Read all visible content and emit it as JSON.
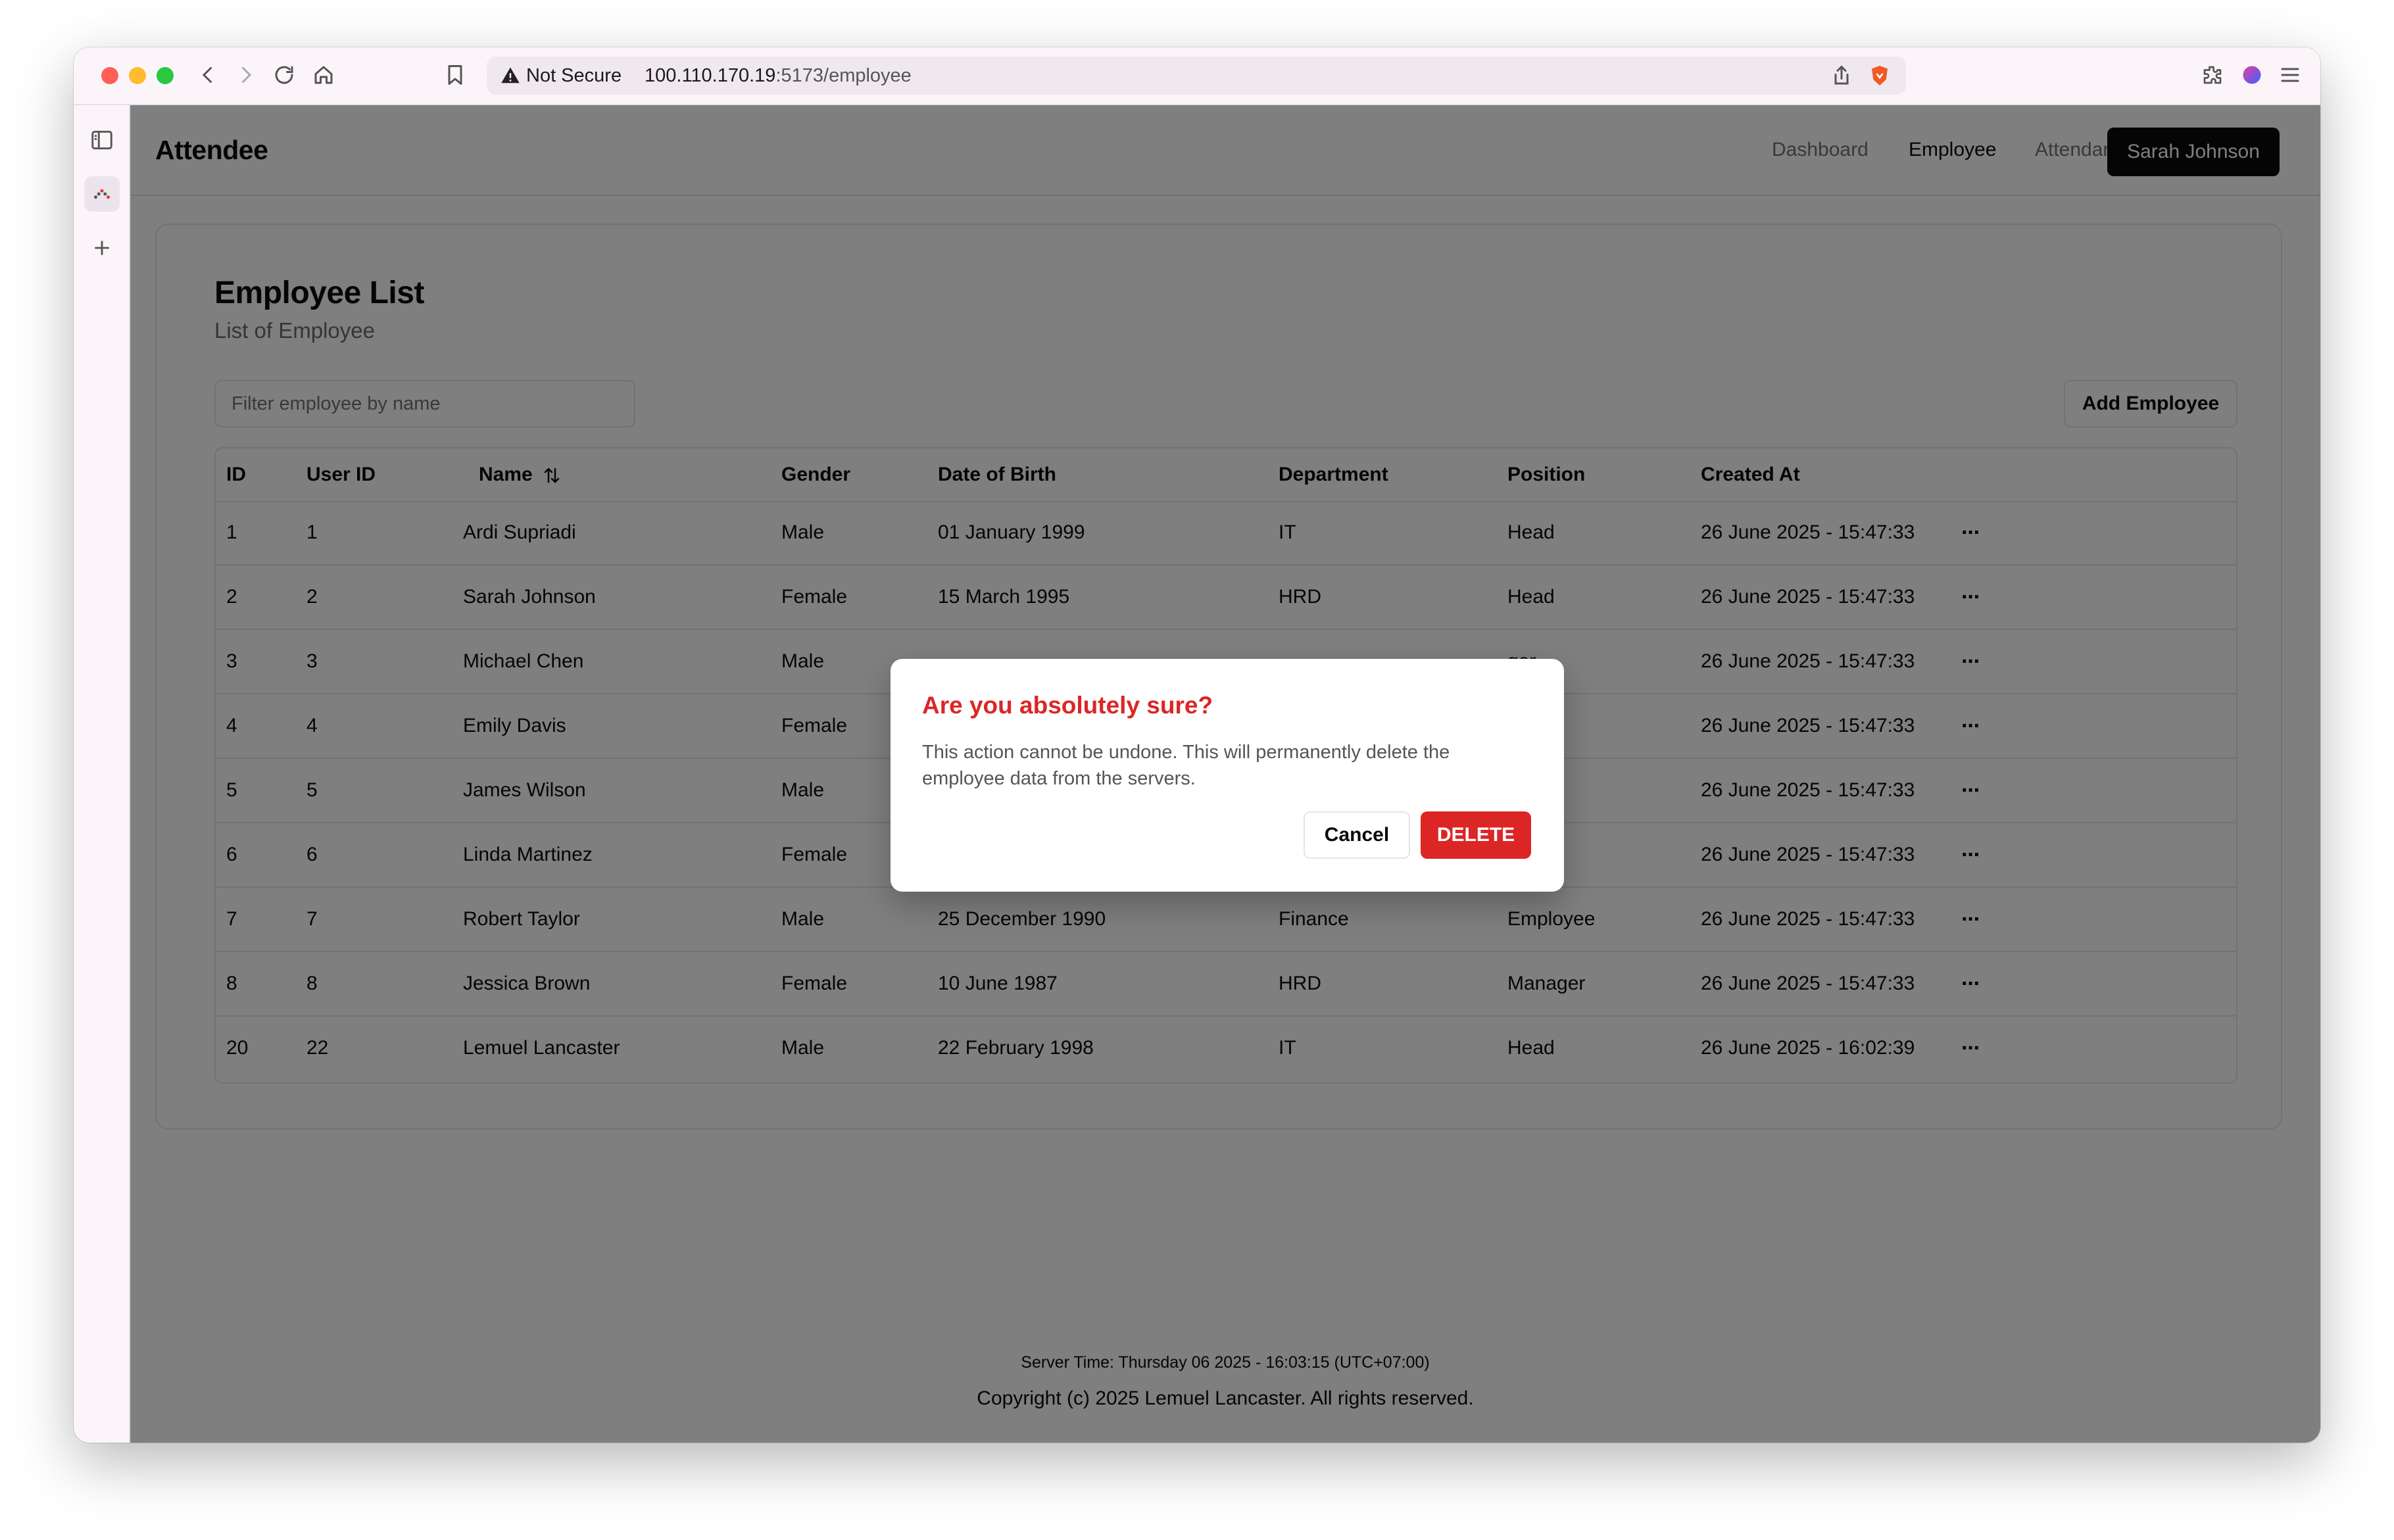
{
  "browser": {
    "security_label": "Not Secure",
    "url_host": "100.110.170.19",
    "url_path": ":5173/employee"
  },
  "app": {
    "brand": "Attendee",
    "nav": [
      "Dashboard",
      "Employee",
      "Attendance"
    ],
    "user_button": "Sarah Johnson"
  },
  "page": {
    "title": "Employee List",
    "subtitle": "List of Employee",
    "filter_placeholder": "Filter employee by name",
    "add_button": "Add Employee"
  },
  "table": {
    "headers": [
      "ID",
      "User ID",
      "Name",
      "Gender",
      "Date of Birth",
      "Department",
      "Position",
      "Created At"
    ],
    "rows": [
      [
        "1",
        "1",
        "Ardi Supriadi",
        "Male",
        "01 January 1999",
        "IT",
        "Head",
        "26 June 2025 - 15:47:33"
      ],
      [
        "2",
        "2",
        "Sarah Johnson",
        "Female",
        "15 March 1995",
        "HRD",
        "Head",
        "26 June 2025 - 15:47:33"
      ],
      [
        "3",
        "3",
        "Michael Chen",
        "Male",
        "",
        "",
        "ger",
        "26 June 2025 - 15:47:33"
      ],
      [
        "4",
        "4",
        "Emily Davis",
        "Female",
        "",
        "",
        "yee",
        "26 June 2025 - 15:47:33"
      ],
      [
        "5",
        "5",
        "James Wilson",
        "Male",
        "",
        "",
        "ger",
        "26 June 2025 - 15:47:33"
      ],
      [
        "6",
        "6",
        "Linda Martinez",
        "Female",
        "",
        "",
        "yee",
        "26 June 2025 - 15:47:33"
      ],
      [
        "7",
        "7",
        "Robert Taylor",
        "Male",
        "25 December 1990",
        "Finance",
        "Employee",
        "26 June 2025 - 15:47:33"
      ],
      [
        "8",
        "8",
        "Jessica Brown",
        "Female",
        "10 June 1987",
        "HRD",
        "Manager",
        "26 June 2025 - 15:47:33"
      ],
      [
        "20",
        "22",
        "Lemuel Lancaster",
        "Male",
        "22 February 1998",
        "IT",
        "Head",
        "26 June 2025 - 16:02:39"
      ]
    ],
    "row_action": "···"
  },
  "footer": {
    "server_time": "Server Time: Thursday 06 2025 - 16:03:15 (UTC+07:00)",
    "copyright": "Copyright (c) 2025 Lemuel Lancaster. All rights reserved."
  },
  "dialog": {
    "title": "Are you absolutely sure?",
    "body": "This action cannot be undone. This will permanently delete the employee data from the servers.",
    "cancel": "Cancel",
    "confirm": "DELETE"
  },
  "colors": {
    "destructive": "#dc2626",
    "primary": "#0a0a0a",
    "overlay": "rgba(0,0,0,0.5)"
  }
}
